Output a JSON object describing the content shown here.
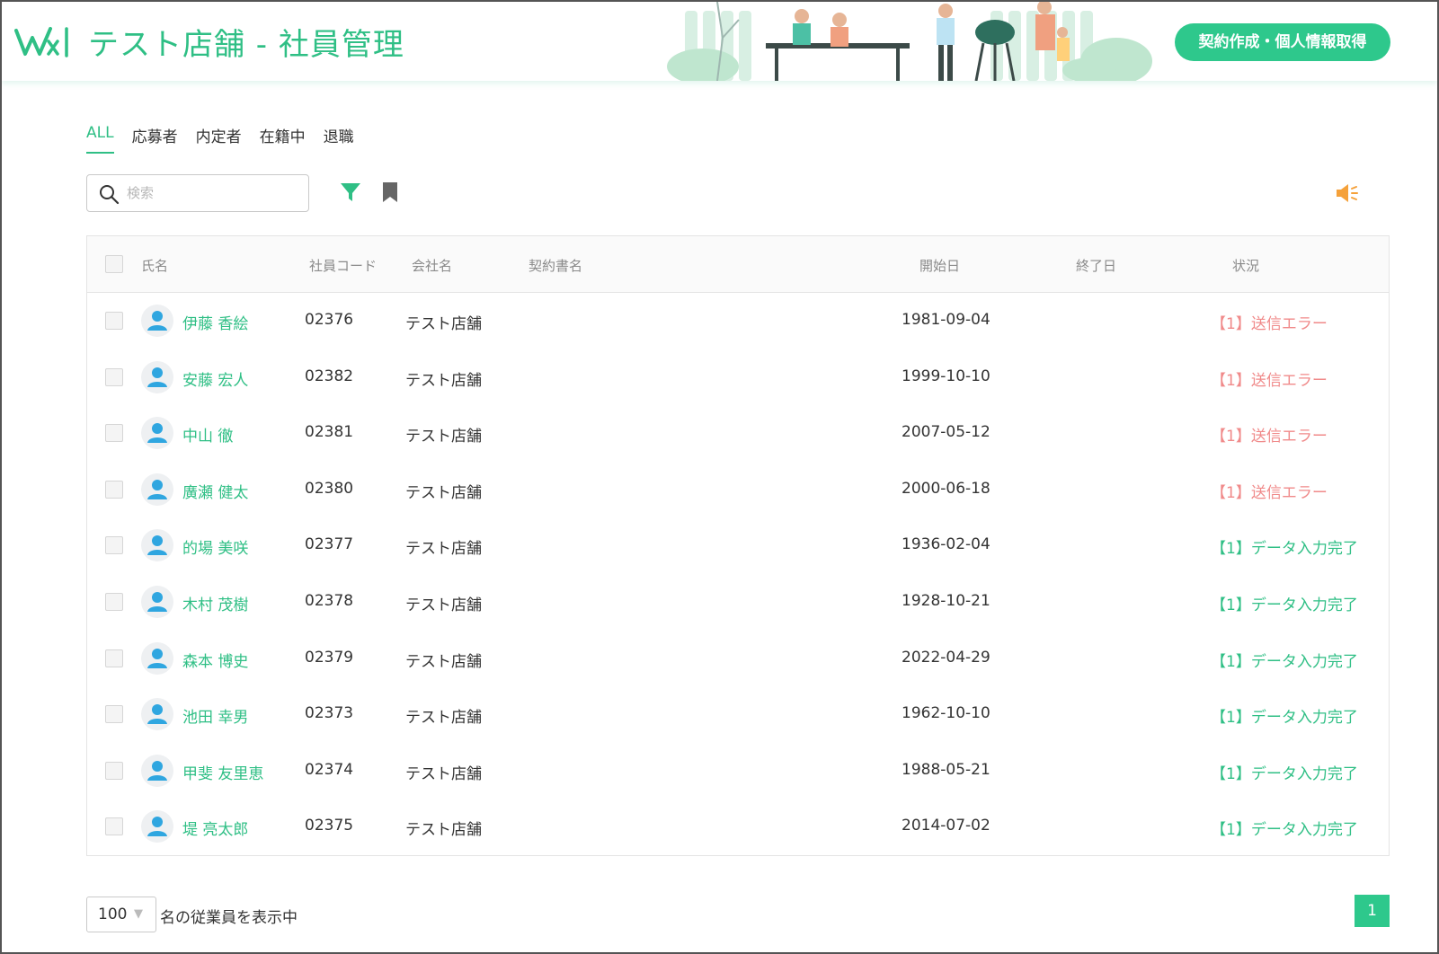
{
  "header": {
    "app_title": "テスト店舗 - 社員管理",
    "cta_label": "契約作成・個人情報取得"
  },
  "tabs": [
    {
      "label": "ALL",
      "active": true
    },
    {
      "label": "応募者",
      "active": false
    },
    {
      "label": "内定者",
      "active": false
    },
    {
      "label": "在籍中",
      "active": false
    },
    {
      "label": "退職",
      "active": false
    }
  ],
  "toolbar": {
    "search_placeholder": "検索",
    "search_value": "",
    "icons": [
      "search-icon",
      "filter-icon",
      "bookmark-icon",
      "speaker-icon"
    ]
  },
  "table": {
    "columns": [
      "氏名",
      "社員コード",
      "会社名",
      "契約書名",
      "開始日",
      "終了日",
      "状況"
    ],
    "rows": [
      {
        "name": "伊藤 香絵",
        "code": "02376",
        "company": "テスト店舗",
        "contract": "",
        "start": "1981-09-04",
        "end": "",
        "status": "【1】送信エラー",
        "status_type": "error"
      },
      {
        "name": "安藤 宏人",
        "code": "02382",
        "company": "テスト店舗",
        "contract": "",
        "start": "1999-10-10",
        "end": "",
        "status": "【1】送信エラー",
        "status_type": "error"
      },
      {
        "name": "中山 徹",
        "code": "02381",
        "company": "テスト店舗",
        "contract": "",
        "start": "2007-05-12",
        "end": "",
        "status": "【1】送信エラー",
        "status_type": "error"
      },
      {
        "name": "廣瀬 健太",
        "code": "02380",
        "company": "テスト店舗",
        "contract": "",
        "start": "2000-06-18",
        "end": "",
        "status": "【1】送信エラー",
        "status_type": "error"
      },
      {
        "name": "的場 美咲",
        "code": "02377",
        "company": "テスト店舗",
        "contract": "",
        "start": "1936-02-04",
        "end": "",
        "status": "【1】データ入力完了",
        "status_type": "ok"
      },
      {
        "name": "木村 茂樹",
        "code": "02378",
        "company": "テスト店舗",
        "contract": "",
        "start": "1928-10-21",
        "end": "",
        "status": "【1】データ入力完了",
        "status_type": "ok"
      },
      {
        "name": "森本 博史",
        "code": "02379",
        "company": "テスト店舗",
        "contract": "",
        "start": "2022-04-29",
        "end": "",
        "status": "【1】データ入力完了",
        "status_type": "ok"
      },
      {
        "name": "池田 幸男",
        "code": "02373",
        "company": "テスト店舗",
        "contract": "",
        "start": "1962-10-10",
        "end": "",
        "status": "【1】データ入力完了",
        "status_type": "ok"
      },
      {
        "name": "甲斐 友里恵",
        "code": "02374",
        "company": "テスト店舗",
        "contract": "",
        "start": "1988-05-21",
        "end": "",
        "status": "【1】データ入力完了",
        "status_type": "ok"
      },
      {
        "name": "堤 亮太郎",
        "code": "02375",
        "company": "テスト店舗",
        "contract": "",
        "start": "2014-07-02",
        "end": "",
        "status": "【1】データ入力完了",
        "status_type": "ok"
      }
    ]
  },
  "footer": {
    "page_size": "100",
    "page_size_label": "名の従業員を表示中",
    "current_page": "1"
  },
  "colors": {
    "accent": "#2fbf85",
    "error": "#f08a8a",
    "warning_icon": "#f5a13a"
  }
}
